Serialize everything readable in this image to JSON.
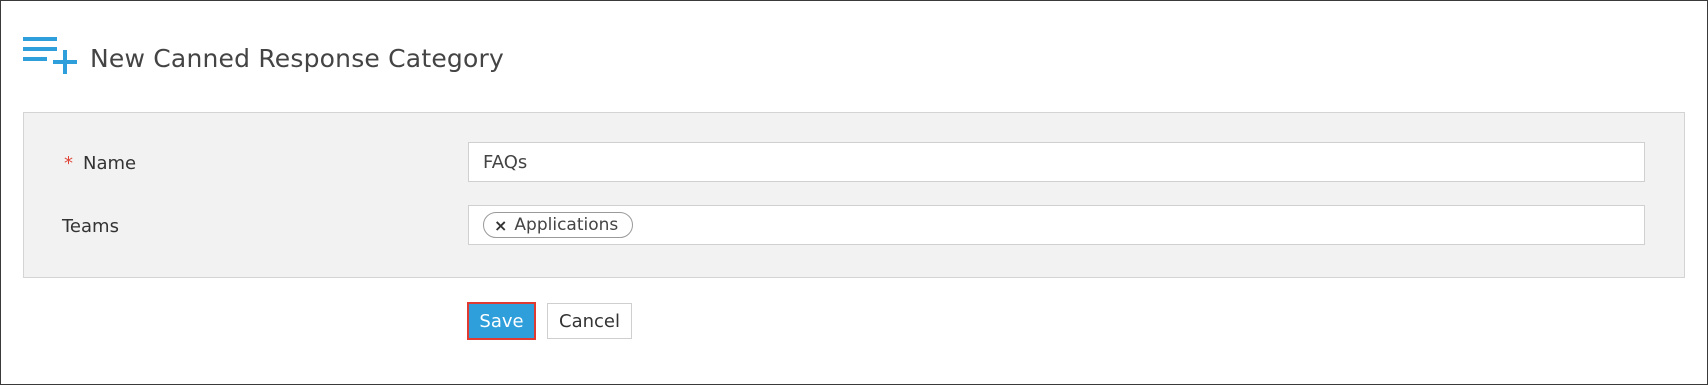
{
  "header": {
    "title": "New Canned Response Category",
    "icon": "list-add-icon",
    "accent_color": "#2e9fdb"
  },
  "form": {
    "name": {
      "label": "Name",
      "required_marker": "*",
      "value": "FAQs"
    },
    "teams": {
      "label": "Teams",
      "chips": [
        {
          "label": "Applications",
          "remove_glyph": "×"
        }
      ]
    }
  },
  "actions": {
    "save_label": "Save",
    "cancel_label": "Cancel",
    "save_color": "#2e9fdb",
    "highlight_color": "#e03b32"
  }
}
